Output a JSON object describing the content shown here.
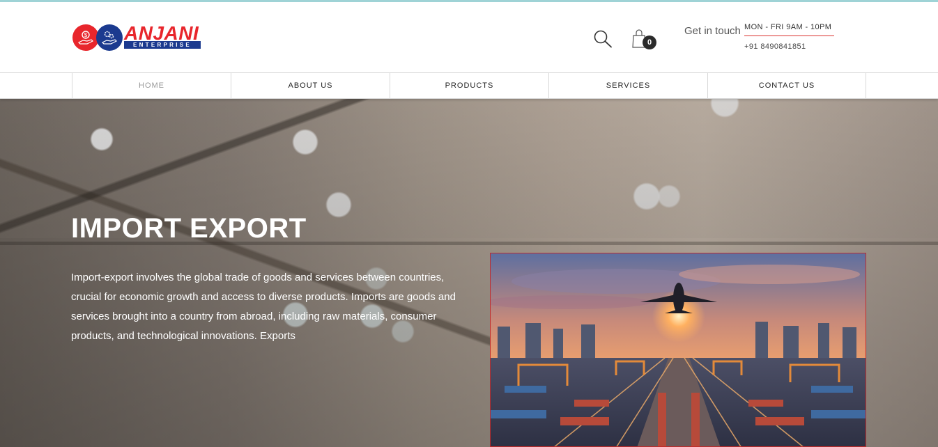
{
  "brand": {
    "name": "ANJANI",
    "tagline": "ENTERPRISE"
  },
  "header": {
    "cart_count": "0",
    "get_in_touch": "Get in touch",
    "hours": "MON - FRI 9AM - 10PM",
    "phone": "+91 8490841851"
  },
  "nav": {
    "items": [
      {
        "label": "HOME"
      },
      {
        "label": "ABOUT US"
      },
      {
        "label": "PRODUCTS"
      },
      {
        "label": "SERVICES"
      },
      {
        "label": "CONTACT US"
      }
    ]
  },
  "hero": {
    "title": "IMPORT EXPORT",
    "body": "Import-export involves the global trade of goods and services between countries, crucial for economic growth and access to diverse products. Imports are goods and services brought into a country from abroad, including raw materials, consumer products, and technological innovations. Exports"
  },
  "colors": {
    "brand_red": "#e8262c",
    "brand_blue": "#1b3a8f",
    "accent_teal": "#9fd3d6"
  }
}
